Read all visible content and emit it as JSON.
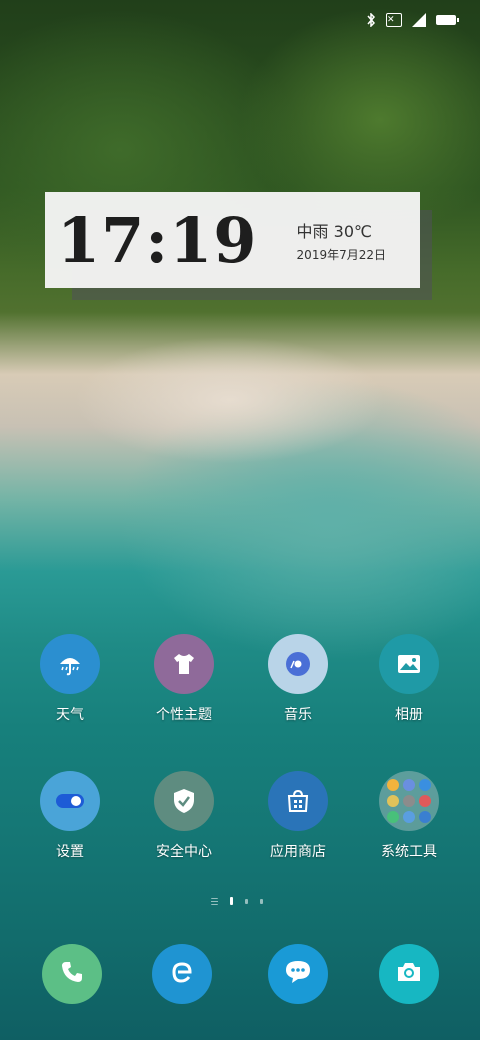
{
  "status_bar": {
    "bluetooth_icon": "bluetooth-icon",
    "sim_icon": "no-sim-icon",
    "sim_symbol": "✕",
    "signal_icon": "signal-icon",
    "battery_icon": "battery-charging-icon"
  },
  "widget": {
    "time": "17:19",
    "weather": "中雨 30℃",
    "date": "2019年7月22日"
  },
  "apps": [
    {
      "label": "天气",
      "icon": "umbrella-icon",
      "color": "#2b8fd0"
    },
    {
      "label": "个性主题",
      "icon": "tshirt-icon",
      "color": "#8f6a9a"
    },
    {
      "label": "音乐",
      "icon": "music-disc-icon",
      "color": "#b9d4e8"
    },
    {
      "label": "相册",
      "icon": "image-icon",
      "color": "#1f9aa6"
    },
    {
      "label": "设置",
      "icon": "toggle-icon",
      "color": "#4aa4d8"
    },
    {
      "label": "安全中心",
      "icon": "shield-check-icon",
      "color": "#5e8c80"
    },
    {
      "label": "应用商店",
      "icon": "store-bag-icon",
      "color": "#2a74b8"
    },
    {
      "label": "系统工具",
      "icon": "folder-icon",
      "color": "#3f8f94"
    }
  ],
  "dock": [
    {
      "name": "phone",
      "icon": "phone-icon",
      "color": "#5cbf86"
    },
    {
      "name": "browser",
      "icon": "browser-e-icon",
      "color": "#1f94d2"
    },
    {
      "name": "messages",
      "icon": "chat-bubble-icon",
      "color": "#1a9ad6"
    },
    {
      "name": "camera",
      "icon": "camera-icon",
      "color": "#17b7c2"
    }
  ],
  "pager": {
    "pages": 3,
    "current": 1
  }
}
